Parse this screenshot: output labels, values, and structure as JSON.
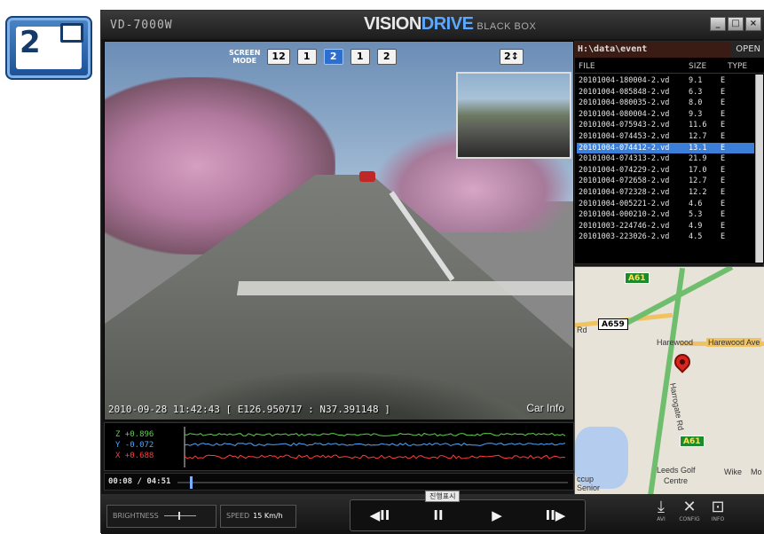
{
  "corner_icon": {
    "number": "2"
  },
  "window": {
    "title": "VD-7000W",
    "logo_part1": "VISION",
    "logo_part2": "DRIVE",
    "logo_sub": "BLACK BOX",
    "buttons": [
      "_",
      "□",
      "×"
    ]
  },
  "screen_mode": {
    "label_line1": "SCREEN",
    "label_line2": "MODE",
    "buttons": [
      "12",
      "1",
      "2",
      "1",
      "2"
    ],
    "active_index": 2,
    "right_button": "2↕"
  },
  "video": {
    "timestamp": "2010-09-28 11:42:43 [ E126.950717 : N37.391148 ]",
    "car_info_label": "Car Info"
  },
  "file_panel": {
    "path": "H:\\data\\event",
    "open_label": "OPEN",
    "columns": [
      "FILE",
      "SIZE",
      "TYPE"
    ],
    "files": [
      {
        "name": "20101004-180004-2.vd",
        "size": "9.1",
        "type": "E"
      },
      {
        "name": "20101004-085848-2.vd",
        "size": "6.3",
        "type": "E"
      },
      {
        "name": "20101004-080035-2.vd",
        "size": "8.0",
        "type": "E"
      },
      {
        "name": "20101004-080004-2.vd",
        "size": "9.3",
        "type": "E"
      },
      {
        "name": "20101004-075943-2.vd",
        "size": "11.6",
        "type": "E"
      },
      {
        "name": "20101004-074453-2.vd",
        "size": "12.7",
        "type": "E"
      },
      {
        "name": "20101004-074412-2.vd",
        "size": "13.1",
        "type": "E"
      },
      {
        "name": "20101004-074313-2.vd",
        "size": "21.9",
        "type": "E"
      },
      {
        "name": "20101004-074229-2.vd",
        "size": "17.0",
        "type": "E"
      },
      {
        "name": "20101004-072658-2.vd",
        "size": "12.7",
        "type": "E"
      },
      {
        "name": "20101004-072328-2.vd",
        "size": "12.2",
        "type": "E"
      },
      {
        "name": "20101004-005221-2.vd",
        "size": "4.6",
        "type": "E"
      },
      {
        "name": "20101004-000210-2.vd",
        "size": "5.3",
        "type": "E"
      },
      {
        "name": "20101003-224746-2.vd",
        "size": "4.9",
        "type": "E"
      },
      {
        "name": "20101003-223026-2.vd",
        "size": "4.5",
        "type": "E"
      }
    ],
    "selected_index": 6
  },
  "map": {
    "shields": [
      "A61",
      "A659",
      "A61"
    ],
    "labels": [
      "Rd",
      "Harewood",
      "Harewood Ave",
      "Harrogate Rd",
      "Leeds Golf",
      "Centre",
      "Wike",
      "Mo",
      "ccup",
      "Senior"
    ]
  },
  "gsensor": {
    "z_label": "Z +0.896",
    "y_label": "Y -0.072",
    "x_label": "X +0.688",
    "colors": {
      "z": "#5fd14b",
      "y": "#4ba6ff",
      "x": "#ff3d3d"
    }
  },
  "timeline": {
    "time": "00:08 / 04:51",
    "progress": 0.03
  },
  "controls": {
    "brightness_label": "BRIGHTNESS",
    "speed_label": "SPEED",
    "speed_value": "15 Km/h",
    "progress_tag": "진행표시",
    "playback": [
      "◀II",
      "II",
      "▶",
      "II▶"
    ],
    "tools": [
      {
        "icon": "download-icon",
        "glyph": "⤓",
        "label": "AVI"
      },
      {
        "icon": "wrench-icon",
        "glyph": "✕",
        "label": "CONFIG"
      },
      {
        "icon": "info-icon",
        "glyph": "⊡",
        "label": "INFO"
      }
    ]
  }
}
